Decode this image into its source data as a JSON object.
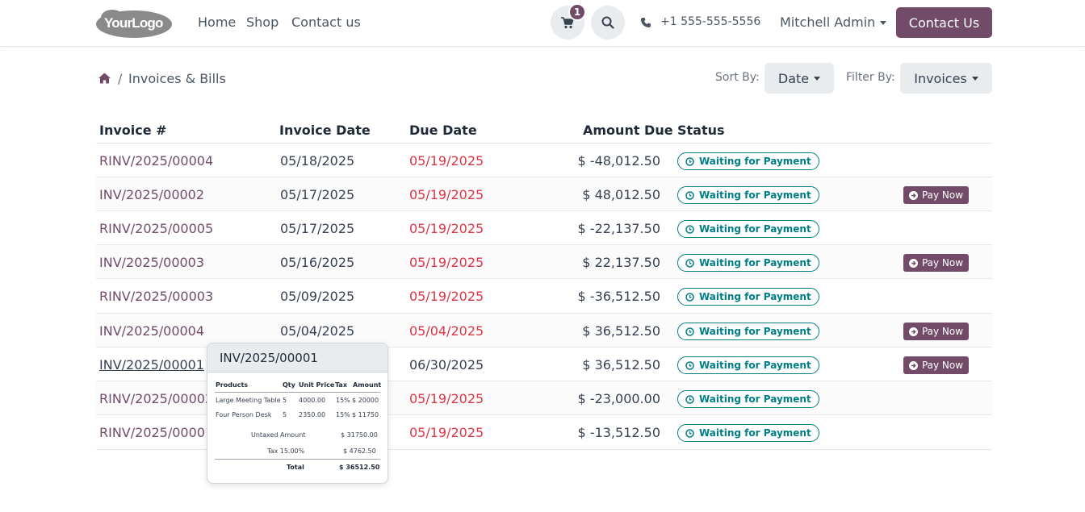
{
  "header": {
    "logo_text": "YourLogo",
    "nav": {
      "home": "Home",
      "shop": "Shop",
      "contact": "Contact us"
    },
    "cart_count": "1",
    "phone": "+1 555-555-5556",
    "user": "Mitchell Admin",
    "contact_button": "Contact Us"
  },
  "breadcrumb": {
    "separator": "/",
    "title": "Invoices & Bills"
  },
  "toolbar": {
    "sort_label": "Sort By:",
    "sort_value": "Date",
    "filter_label": "Filter By:",
    "filter_value": "Invoices"
  },
  "table": {
    "headers": {
      "invoice": "Invoice #",
      "invoice_date": "Invoice Date",
      "due_date": "Due Date",
      "amount_due": "Amount Due",
      "status": "Status"
    },
    "rows": [
      {
        "invoice": "RINV/2025/00004",
        "date": "05/18/2025",
        "due": "05/19/2025",
        "amount": "$ -48,012.50",
        "status": "Waiting for Payment"
      },
      {
        "invoice": "INV/2025/00002",
        "date": "05/17/2025",
        "due": "05/19/2025",
        "amount": "$ 48,012.50",
        "status": "Waiting for Payment",
        "action": "Pay Now"
      },
      {
        "invoice": "RINV/2025/00005",
        "date": "05/17/2025",
        "due": "05/19/2025",
        "amount": "$ -22,137.50",
        "status": "Waiting for Payment"
      },
      {
        "invoice": "INV/2025/00003",
        "date": "05/16/2025",
        "due": "05/19/2025",
        "amount": "$ 22,137.50",
        "status": "Waiting for Payment",
        "action": "Pay Now"
      },
      {
        "invoice": "RINV/2025/00003",
        "date": "05/09/2025",
        "due": "05/19/2025",
        "amount": "$ -36,512.50",
        "status": "Waiting for Payment"
      },
      {
        "invoice": "INV/2025/00004",
        "date": "05/04/2025",
        "due": "05/04/2025",
        "amount": "$ 36,512.50",
        "status": "Waiting for Payment",
        "action": "Pay Now"
      },
      {
        "invoice": "INV/2025/00001",
        "date": "",
        "due": "06/30/2025",
        "amount": "$ 36,512.50",
        "status": "Waiting for Payment",
        "action": "Pay Now"
      },
      {
        "invoice": "RINV/2025/00002",
        "date": "",
        "due": "05/19/2025",
        "amount": "$ -23,000.00",
        "status": "Waiting for Payment"
      },
      {
        "invoice": "RINV/2025/00001",
        "date": "",
        "due": "05/19/2025",
        "amount": "$ -13,512.50",
        "status": "Waiting for Payment"
      }
    ]
  },
  "popover": {
    "title": "INV/2025/00001",
    "headers": {
      "products": "Products",
      "qty": "Qty",
      "unit_price": "Unit Price",
      "tax": "Tax",
      "amount": "Amount"
    },
    "lines": [
      {
        "product": "Large Meeting Table",
        "qty": "5",
        "price": "4000.00",
        "tax": "15%",
        "amount": "$ 20000"
      },
      {
        "product": "Four Person Desk",
        "qty": "5",
        "price": "2350.00",
        "tax": "15%",
        "amount": "$ 11750"
      }
    ],
    "untaxed_label": "Untaxed Amount",
    "untaxed_value": "$ 31750.00",
    "tax_label": "Tax 15.00%",
    "tax_value": "$ 4762.50",
    "total_label": "Total",
    "total_value": "$ 36512.50"
  },
  "colors": {
    "brand": "#714b67",
    "due_red": "#dc3545",
    "status_teal": "#017e84"
  }
}
